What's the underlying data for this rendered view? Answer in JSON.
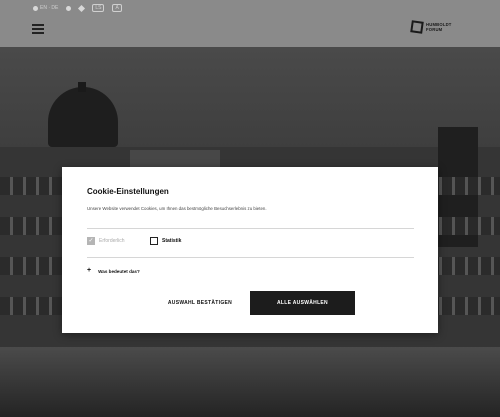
{
  "utility": {
    "items": [
      {
        "icon": "globe-icon",
        "label": "EN · DE"
      },
      {
        "icon": "sign-language-icon",
        "label": ""
      },
      {
        "icon": "accessibility-icon",
        "label": ""
      },
      {
        "icon": "easy-language-icon",
        "label": "LS"
      },
      {
        "icon": "audio-icon",
        "label": "A"
      }
    ]
  },
  "logo": {
    "line1": "HUMBOLDT",
    "line2": "FORUM"
  },
  "dialog": {
    "title": "Cookie-Einstellungen",
    "text": "Unsere Website verwendet Cookies, um Ihnen das bestmögliche Besuchserlebnis zu bieten.",
    "options": [
      {
        "label": "Erforderlich",
        "checked": true,
        "disabled": true
      },
      {
        "label": "Statistik",
        "checked": false,
        "disabled": false
      }
    ],
    "more": "Was bedeutet das?",
    "confirm_label": "AUSWAHL BESTÄTIGEN",
    "all_label": "ALLE AUSWÄHLEN"
  },
  "colors": {
    "dialog_bg": "#ffffff",
    "button_dark": "#1c1c1c",
    "overlay": "#8a8a8a"
  }
}
